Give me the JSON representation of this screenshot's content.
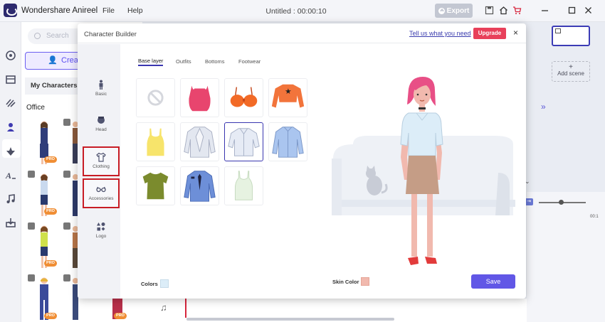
{
  "app": {
    "name": "Wondershare Anireel",
    "menu": [
      "File",
      "Help"
    ],
    "window_title": "Untitled : 00:00:10",
    "export_label": "Export"
  },
  "library": {
    "search_placeholder": "Search",
    "create_label": "Create",
    "my_characters_label": "My Characters",
    "section_title": "Office",
    "pro_badge": "PRO"
  },
  "scenes": {
    "add_scene_plus": "+",
    "add_scene_label": "Add scene",
    "time_marker": "00:1"
  },
  "dialog": {
    "title": "Character Builder",
    "help_link": "Tell us what you need",
    "upgrade_label": "Upgrade",
    "close_glyph": "×",
    "side_tabs": [
      "Basic",
      "Head",
      "Clothing",
      "Accessories",
      "Logo"
    ],
    "highlighted_tabs": [
      "Clothing",
      "Accessories"
    ],
    "content_tabs": [
      "Base layer",
      "Outfits",
      "Bottoms",
      "Footwear"
    ],
    "active_content_tab": "Base layer",
    "items": [
      {
        "name": "none",
        "color": "#d5d7dd"
      },
      {
        "name": "pink-crop-top",
        "color": "#e8456e"
      },
      {
        "name": "orange-bikini-top",
        "color": "#f26a26"
      },
      {
        "name": "orange-star-crop-top",
        "color": "#f2743b"
      },
      {
        "name": "yellow-tank-top",
        "color": "#f7e46b"
      },
      {
        "name": "white-jacket",
        "color": "#dfe3ee"
      },
      {
        "name": "white-blouse",
        "color": "#e6ebf5",
        "selected": true
      },
      {
        "name": "blue-shirt",
        "color": "#aac5ef"
      },
      {
        "name": "olive-tshirt",
        "color": "#7b8b2d"
      },
      {
        "name": "blue-uniform-shirt",
        "color": "#6d8fd8"
      },
      {
        "name": "green-camisole",
        "color": "#e6f2e1"
      }
    ],
    "colors_label": "Colors",
    "skin_color_label": "Skin Color",
    "save_label": "Save",
    "shirt_color": "#dcedf8",
    "skin_color": "#f1b9ae"
  }
}
